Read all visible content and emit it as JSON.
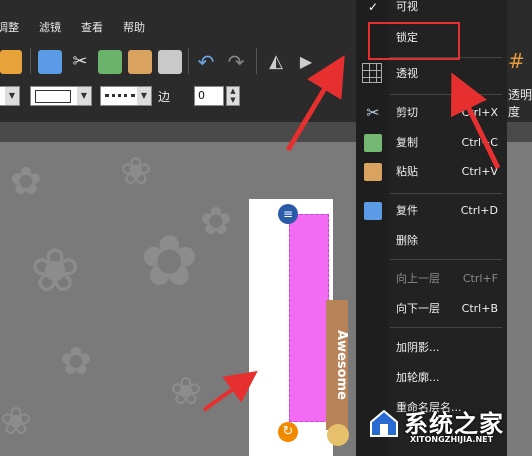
{
  "menubar": {
    "items": [
      "调整",
      "滤镜",
      "查看",
      "帮助"
    ]
  },
  "toolbar": {
    "spin_label": "边",
    "spin_value": "0"
  },
  "right_partial": {
    "label": "透明度"
  },
  "context_menu": {
    "items": [
      {
        "label": "可视",
        "shortcut": "",
        "checked": true,
        "disabled": false,
        "icon": "check-icon"
      },
      {
        "label": "锁定",
        "shortcut": "",
        "disabled": false,
        "icon": ""
      },
      {
        "label": "透视",
        "shortcut": "",
        "disabled": false,
        "icon": "perspective-grid-icon"
      },
      {
        "label": "剪切",
        "shortcut": "Ctrl+X",
        "disabled": false,
        "icon": "scissors-icon"
      },
      {
        "label": "复制",
        "shortcut": "Ctrl+C",
        "disabled": false,
        "icon": "copy-icon"
      },
      {
        "label": "粘贴",
        "shortcut": "Ctrl+V",
        "disabled": false,
        "icon": "paste-icon"
      },
      {
        "label": "复件",
        "shortcut": "Ctrl+D",
        "disabled": false,
        "icon": "duplicate-icon"
      },
      {
        "label": "删除",
        "shortcut": "",
        "disabled": false,
        "icon": ""
      },
      {
        "label": "向上一层",
        "shortcut": "Ctrl+F",
        "disabled": true,
        "icon": ""
      },
      {
        "label": "向下一层",
        "shortcut": "Ctrl+B",
        "disabled": false,
        "icon": ""
      },
      {
        "label": "加阴影...",
        "shortcut": "",
        "disabled": false,
        "icon": ""
      },
      {
        "label": "加轮廓...",
        "shortcut": "",
        "disabled": false,
        "icon": ""
      },
      {
        "label": "重命名层名...",
        "shortcut": "",
        "disabled": false,
        "icon": ""
      }
    ]
  },
  "canvas": {
    "layer_side_text": "Awesome"
  },
  "watermark": {
    "text": "系统之家",
    "url": "XITONGZHIJIA.NET"
  },
  "colors": {
    "highlight": "#e63030",
    "selected_layer": "#f36bf3",
    "menu_bg": "#222222"
  }
}
